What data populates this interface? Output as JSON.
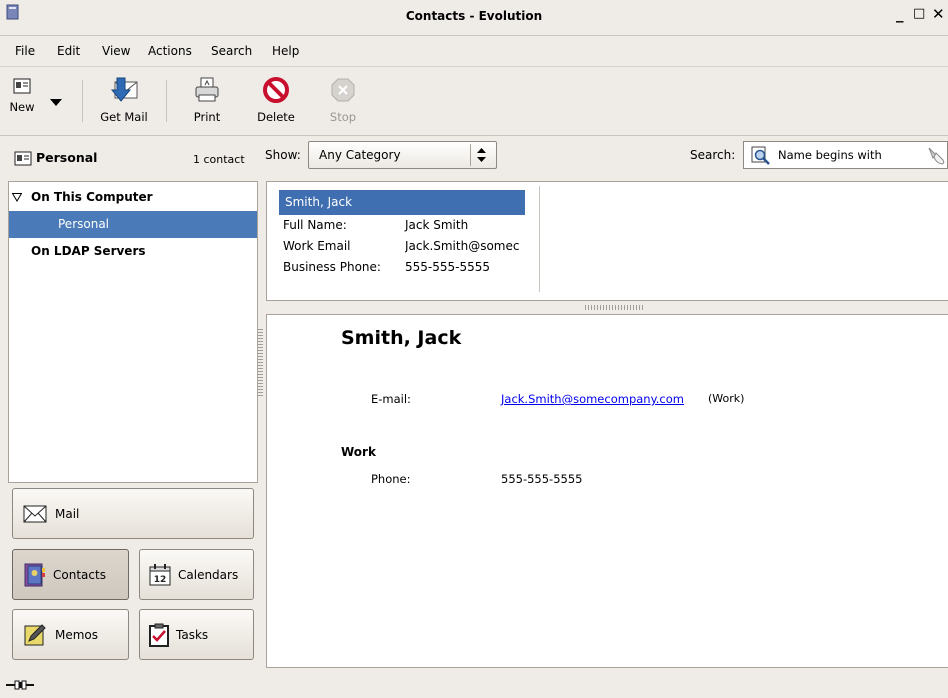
{
  "window": {
    "title": "Contacts - Evolution",
    "minimize": "_",
    "maximize": "□",
    "close": "✕"
  },
  "menu": [
    {
      "label": "File"
    },
    {
      "label": "Edit"
    },
    {
      "label": "View"
    },
    {
      "label": "Actions"
    },
    {
      "label": "Search"
    },
    {
      "label": "Help"
    }
  ],
  "toolbar": {
    "new_label": "New",
    "get_mail_label": "Get Mail",
    "print_label": "Print",
    "delete_label": "Delete",
    "stop_label": "Stop"
  },
  "left_header": {
    "title": "Personal",
    "count": "1 contact"
  },
  "tree": {
    "group1": "On This Computer",
    "group1_item": "Personal",
    "group2": "On LDAP Servers"
  },
  "switcher": {
    "mail": "Mail",
    "contacts": "Contacts",
    "calendars": "Calendars",
    "memos": "Memos",
    "tasks": "Tasks"
  },
  "filter": {
    "show_label": "Show:",
    "category_value": "Any Category",
    "search_label": "Search:",
    "search_mode": "Name begins with"
  },
  "card": {
    "title": "Smith, Jack",
    "fields": [
      {
        "label": "Full Name:",
        "value": "Jack Smith"
      },
      {
        "label": "Work Email",
        "value": "Jack.Smith@somec"
      },
      {
        "label": "Business Phone:",
        "value": "555-555-5555"
      }
    ]
  },
  "detail": {
    "name": "Smith, Jack",
    "email_label": "E-mail:",
    "email_value": "Jack.Smith@somecompany.com",
    "email_type": "(Work)",
    "section": "Work",
    "phone_label": "Phone:",
    "phone_value": "555-555-5555"
  },
  "colors": {
    "selection": "#4a7ab8",
    "selection_card": "#3f6fb0",
    "link": "#0000ee"
  }
}
